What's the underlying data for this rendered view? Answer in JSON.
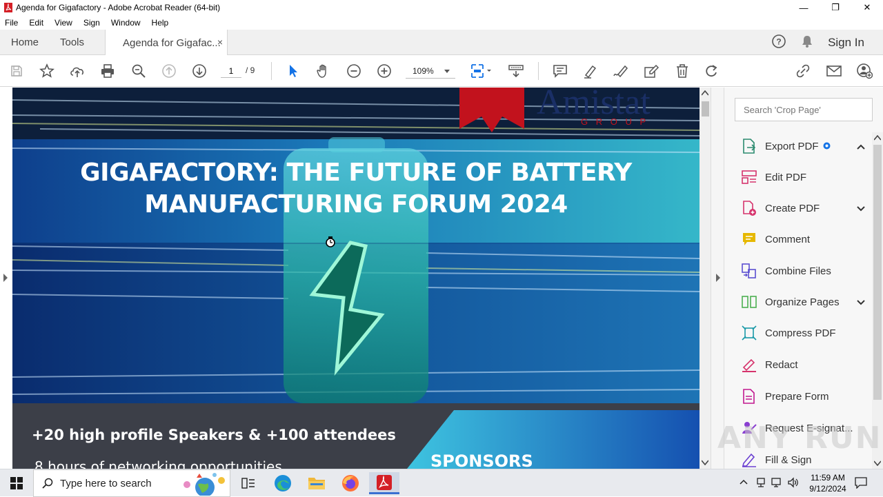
{
  "window": {
    "title": "Agenda for Gigafactory - Adobe Acrobat Reader (64-bit)",
    "minimize_glyph": "—",
    "maximize_glyph": "❐",
    "close_glyph": "✕"
  },
  "menu": [
    "File",
    "Edit",
    "View",
    "Sign",
    "Window",
    "Help"
  ],
  "tabs": {
    "home": "Home",
    "tools": "Tools",
    "document": "Agenda for Gigafac...",
    "close_glyph": "×"
  },
  "header": {
    "sign_in": "Sign In"
  },
  "toolbar": {
    "page_current": "1",
    "page_total": "/ 9",
    "zoom": "109%"
  },
  "document": {
    "brand_text": "Amistat",
    "brand_sub": "G R O U P",
    "headline_line1": "GIGAFACTORY: THE FUTURE OF BATTERY",
    "headline_line2": "MANUFACTURING FORUM 2024",
    "bullet1": "+20 high profile Speakers & +100 attendees",
    "bullet2": "8 hours of networking opportunities",
    "sponsors": "SPONSORS"
  },
  "right_pane": {
    "search_placeholder": "Search 'Crop Page'",
    "items": [
      {
        "label": "Export PDF",
        "icon": "export-pdf-icon",
        "color": "#2a8a6e"
      },
      {
        "label": "Edit PDF",
        "icon": "edit-pdf-icon",
        "color": "#d6336c"
      },
      {
        "label": "Create PDF",
        "icon": "create-pdf-icon",
        "color": "#d6336c"
      },
      {
        "label": "Comment",
        "icon": "comment-icon",
        "color": "#e6b800"
      },
      {
        "label": "Combine Files",
        "icon": "combine-files-icon",
        "color": "#5b4fd1"
      },
      {
        "label": "Organize Pages",
        "icon": "organize-pages-icon",
        "color": "#4caf50"
      },
      {
        "label": "Compress PDF",
        "icon": "compress-pdf-icon",
        "color": "#1a9aa8"
      },
      {
        "label": "Redact",
        "icon": "redact-icon",
        "color": "#d6336c"
      },
      {
        "label": "Prepare Form",
        "icon": "prepare-form-icon",
        "color": "#c2188f"
      },
      {
        "label": "Request E-signat...",
        "icon": "request-esign-icon",
        "color": "#8a3fd1"
      },
      {
        "label": "Fill & Sign",
        "icon": "fill-sign-icon",
        "color": "#6a3fd1"
      }
    ]
  },
  "watermark": "ANY RUN",
  "taskbar": {
    "search_placeholder": "Type here to search",
    "time": "11:59 AM",
    "date": "9/12/2024"
  }
}
